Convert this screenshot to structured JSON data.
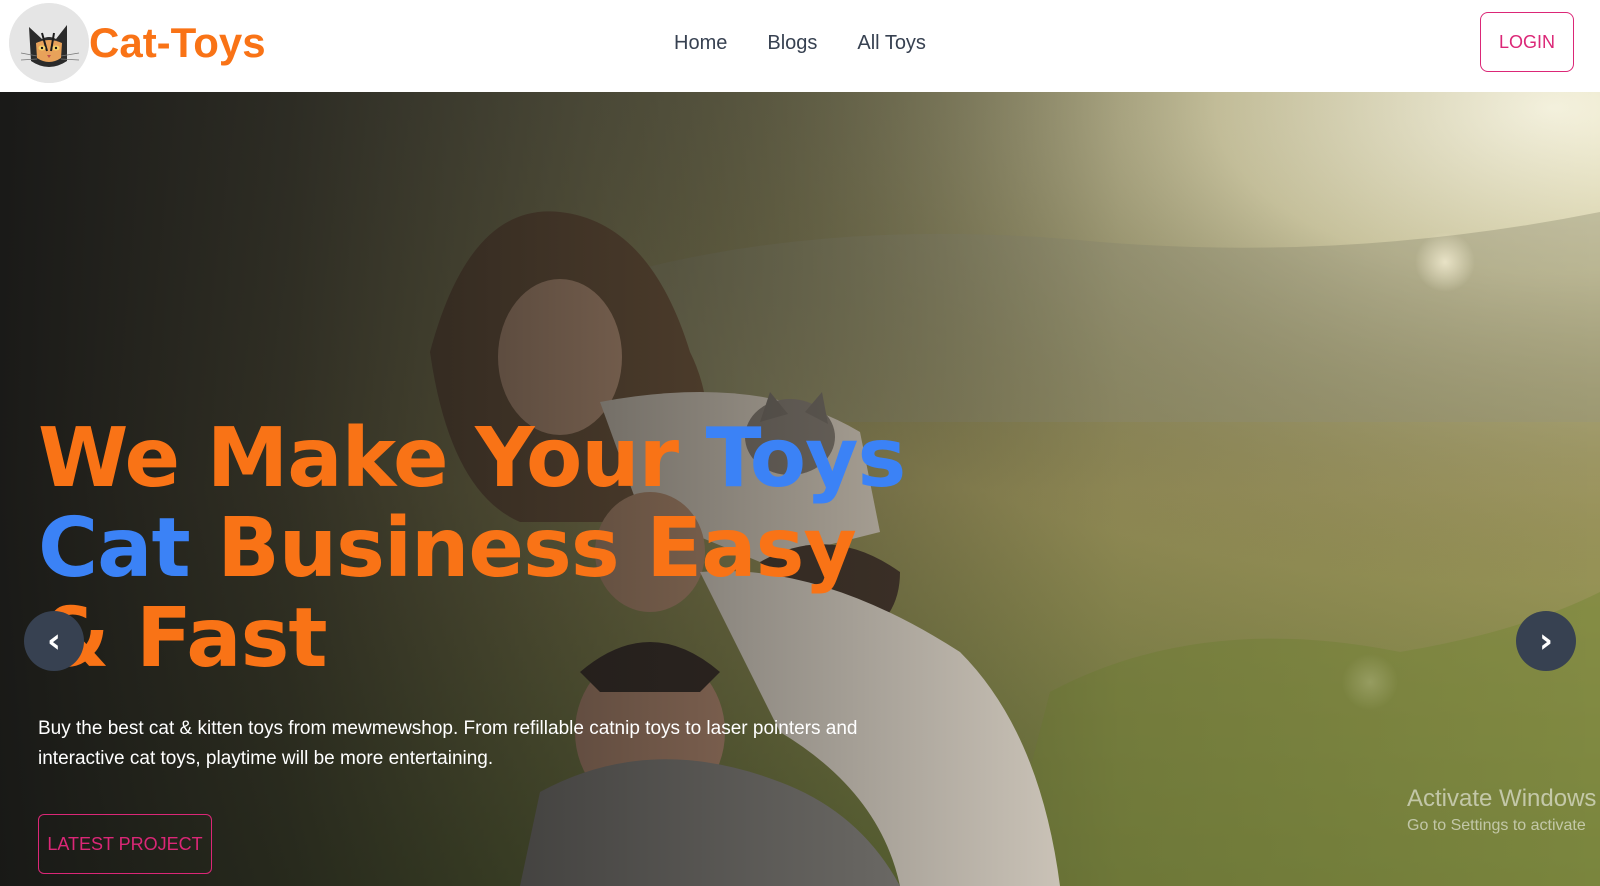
{
  "header": {
    "brand_name": "Cat-Toys",
    "nav": [
      {
        "label": "Home"
      },
      {
        "label": "Blogs"
      },
      {
        "label": "All Toys"
      }
    ],
    "login_label": "LOGIN"
  },
  "hero": {
    "title_part1": "We Make Your ",
    "title_accent": "Toys Cat",
    "title_part2": " Business Easy & Fast",
    "description": "Buy the best cat & kitten toys from mewmewshop. From refillable catnip toys to laser pointers and interactive cat toys, playtime will be more entertaining.",
    "cta_label": "LATEST PROJECT",
    "prev_arrow": "‹",
    "next_arrow": "›"
  },
  "system_watermark": {
    "title": "Activate Windows",
    "subtitle": "Go to Settings to activate"
  },
  "colors": {
    "brand_orange": "#f97316",
    "accent_blue": "#3b82f6",
    "button_pink": "#db2777"
  }
}
